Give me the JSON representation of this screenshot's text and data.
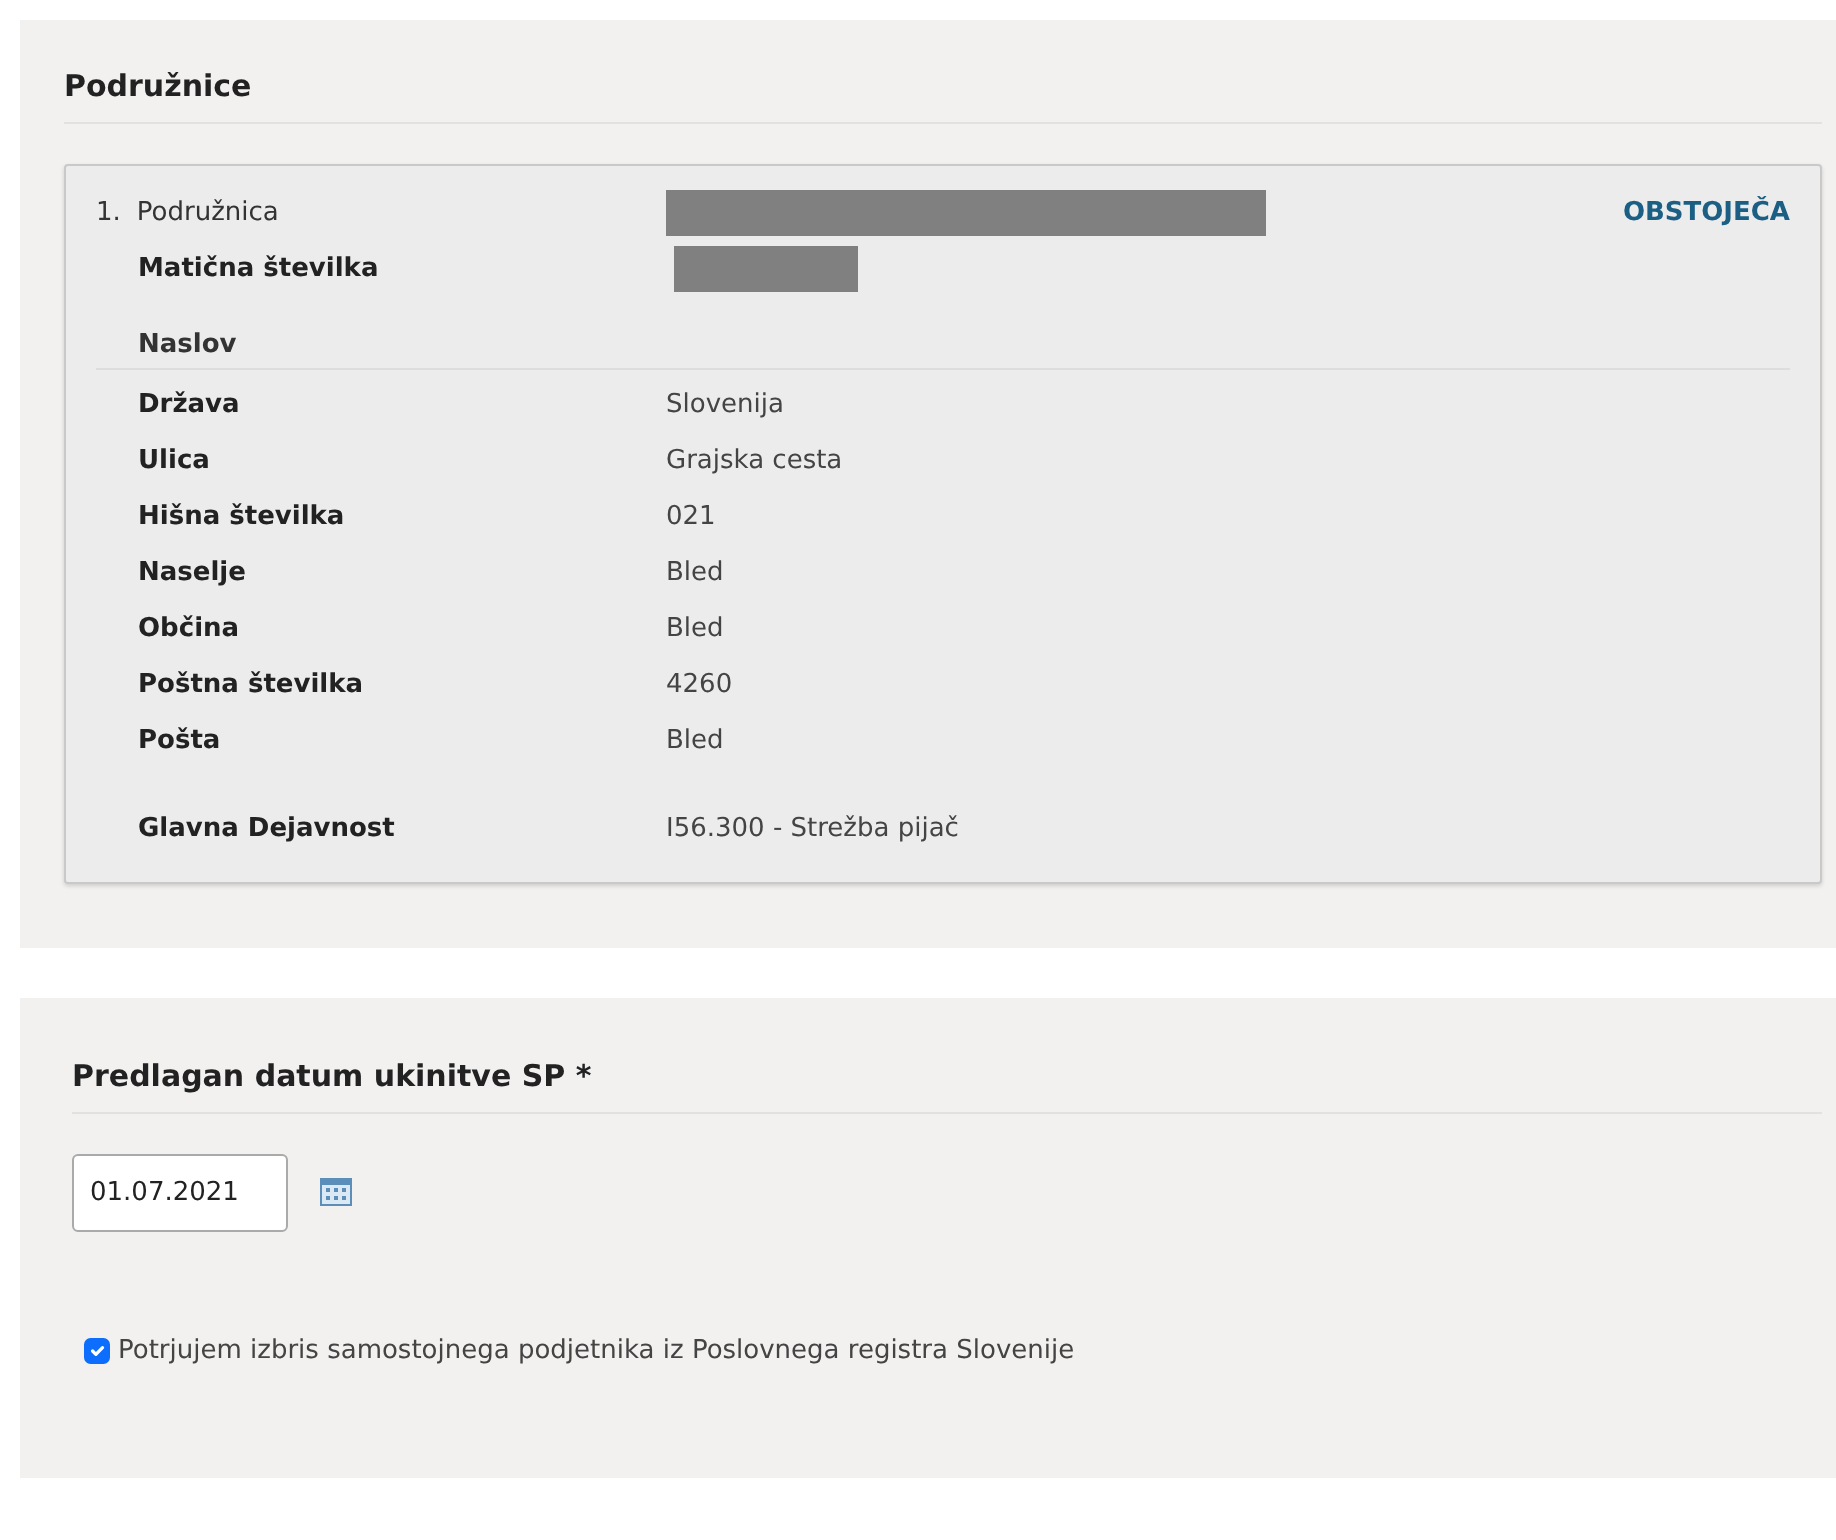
{
  "branches_section": {
    "title": "Podružnice",
    "branches": [
      {
        "number": "1.",
        "title": "Podružnica",
        "value_redacted": true,
        "status": "OBSTOJEČA",
        "id_field": {
          "label": "Matična številka",
          "redacted": true
        },
        "address": {
          "heading": "Naslov",
          "fields": [
            {
              "label": "Država",
              "value": "Slovenija"
            },
            {
              "label": "Ulica",
              "value": "Grajska cesta"
            },
            {
              "label": "Hišna številka",
              "value": "021"
            },
            {
              "label": "Naselje",
              "value": "Bled"
            },
            {
              "label": "Občina",
              "value": "Bled"
            },
            {
              "label": "Poštna številka",
              "value": "4260"
            },
            {
              "label": "Pošta",
              "value": "Bled"
            }
          ]
        },
        "main_activity": {
          "label": "Glavna Dejavnost",
          "value": "I56.300 - Strežba pijač"
        }
      }
    ]
  },
  "closure_section": {
    "title": "Predlagan datum ukinitve SP *",
    "date_field": {
      "value": "01.07.2021"
    },
    "confirm": {
      "label": "Potrjujem izbris samostojnega podjetnika iz Poslovnega registra Slovenije",
      "checked": true
    }
  }
}
